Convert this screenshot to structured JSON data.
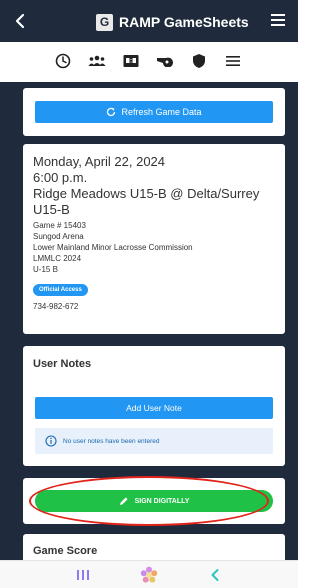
{
  "app": {
    "title": "RAMP GameSheets",
    "logo_letter": "G"
  },
  "tabs": [
    {
      "icon": "clock-icon",
      "active": true
    },
    {
      "icon": "team-icon"
    },
    {
      "icon": "scoreboard-icon"
    },
    {
      "icon": "whistle-icon"
    },
    {
      "icon": "shield-icon"
    },
    {
      "icon": "list-icon"
    }
  ],
  "refresh": {
    "label": "Refresh Game Data"
  },
  "game": {
    "date": "Monday, April 22, 2024",
    "time": "6:00 p.m.",
    "matchup": "Ridge Meadows U15-B @ Delta/Surrey U15-B",
    "game_number": "Game # 15403",
    "arena": "Sungod Arena",
    "association": "Lower Mainland Minor Lacrosse Commission",
    "season": "LMMLC 2024",
    "division": "U-15 B",
    "access_badge": "Official Access",
    "code": "734-982-672"
  },
  "notes": {
    "title": "User Notes",
    "add_label": "Add User Note",
    "empty_message": "No user notes have been entered"
  },
  "sign": {
    "label": "SIGN DIGITALLY"
  },
  "score": {
    "title": "Game Score"
  },
  "colors": {
    "navy": "#1f2b3c",
    "accent": "#2196f3",
    "green": "#1fc146",
    "highlight": "#e0241a"
  }
}
